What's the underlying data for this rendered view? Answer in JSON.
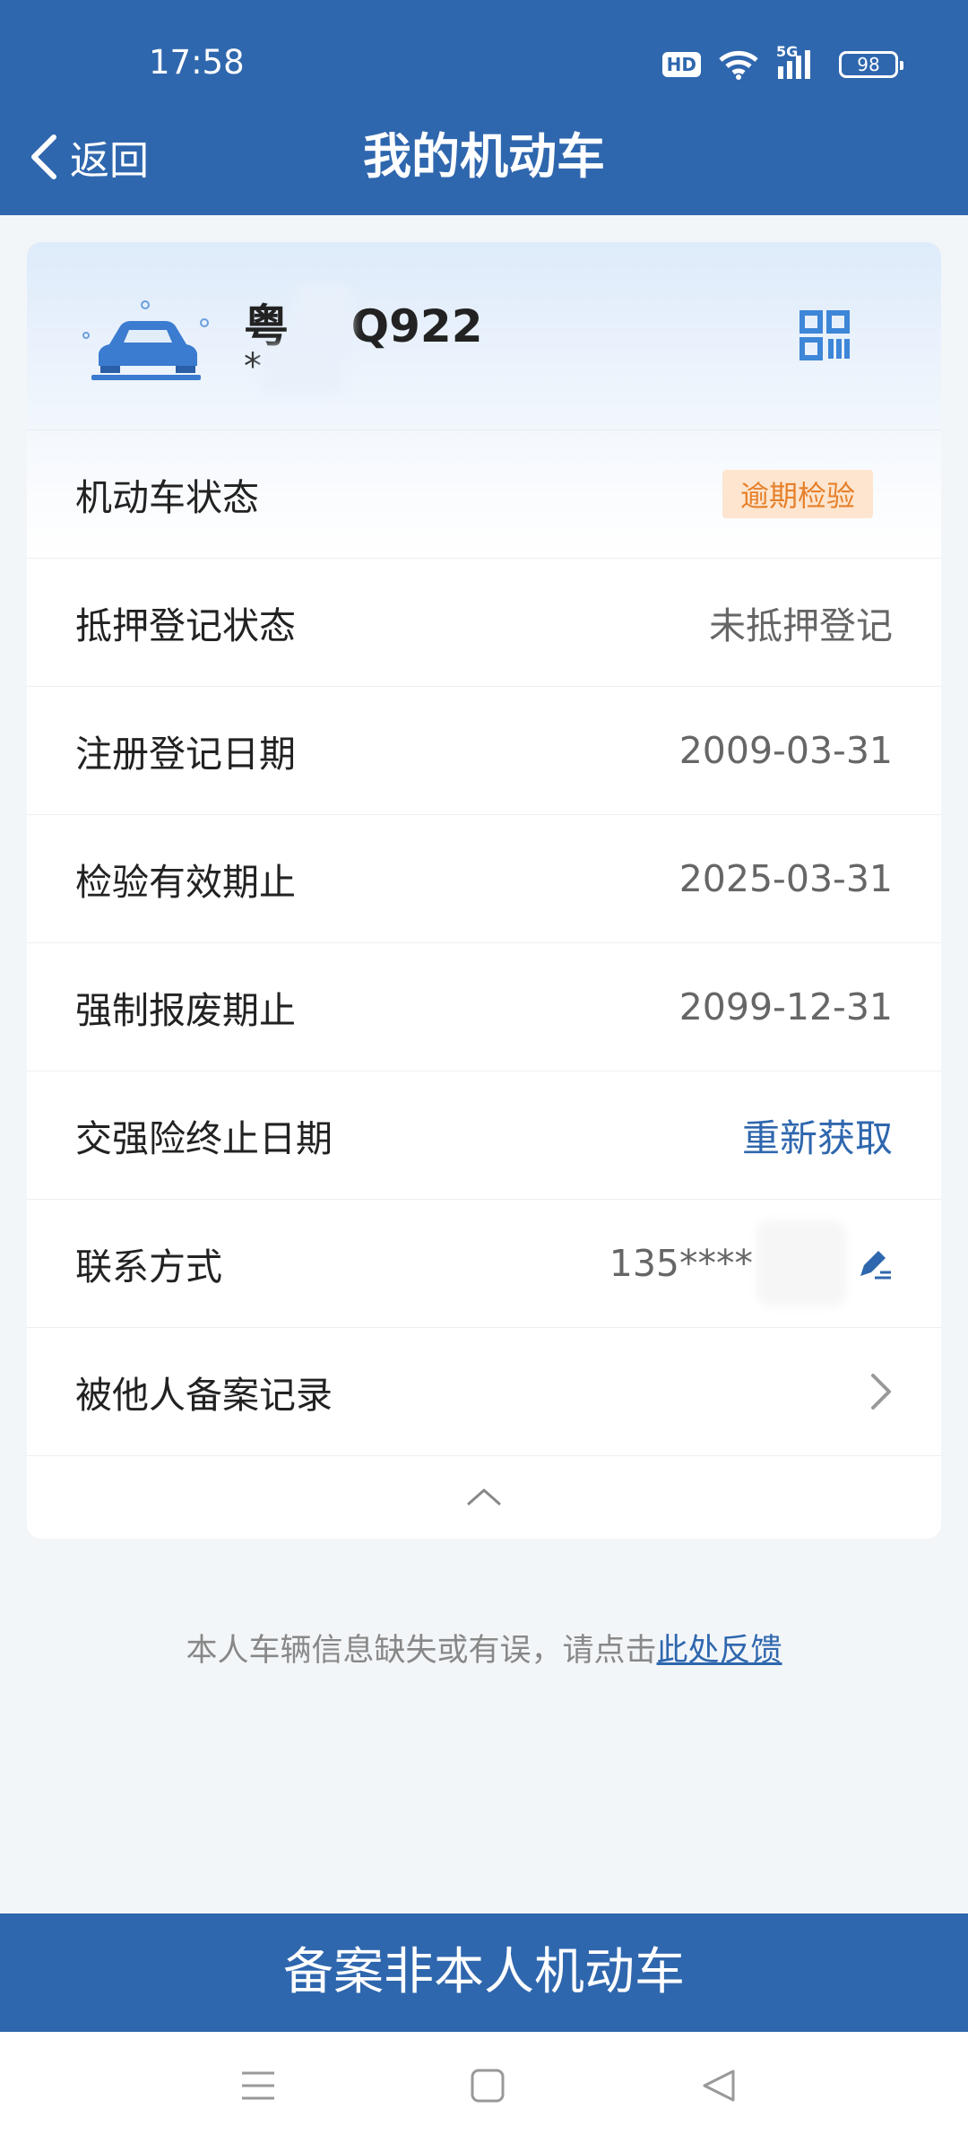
{
  "status_bar": {
    "time": "17:58",
    "hd": "HD",
    "network": "5G",
    "battery": "98"
  },
  "header": {
    "back_label": "返回",
    "title": "我的机动车"
  },
  "vehicle": {
    "plate_prefix": "粤",
    "plate_suffix": "Q922",
    "sub_text": "*"
  },
  "rows": [
    {
      "label": "机动车状态",
      "value": "逾期检验"
    },
    {
      "label": "抵押登记状态",
      "value": "未抵押登记"
    },
    {
      "label": "注册登记日期",
      "value": "2009-03-31"
    },
    {
      "label": "检验有效期止",
      "value": "2025-03-31"
    },
    {
      "label": "强制报废期止",
      "value": "2099-12-31"
    },
    {
      "label": "交强险终止日期",
      "value": "重新获取"
    },
    {
      "label": "联系方式",
      "value": "135****"
    },
    {
      "label": "被他人备案记录",
      "value": ""
    }
  ],
  "feedback": {
    "text": "本人车辆信息缺失或有误，请点击",
    "link": "此处反馈"
  },
  "bottom_button": "备案非本人机动车",
  "colors": {
    "primary": "#2f67ae",
    "badge_text": "#e6802a",
    "badge_bg": "#fde5cf"
  },
  "icons": [
    "back-chevron-icon",
    "car-icon",
    "qr-code-icon",
    "edit-icon",
    "chevron-right-icon",
    "chevron-up-icon",
    "menu-icon",
    "home-icon",
    "back-triangle-icon"
  ]
}
